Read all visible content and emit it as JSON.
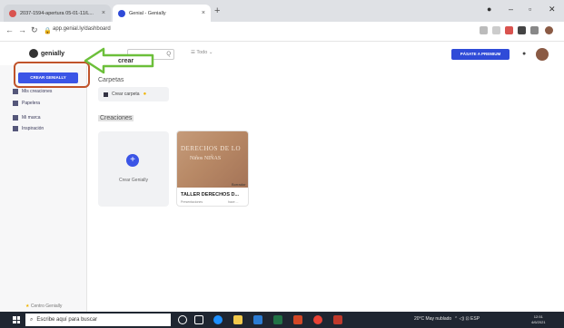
{
  "browser": {
    "tabs": [
      {
        "label": "2037-1594-apertura 05-01-11/L..."
      },
      {
        "label": "Genial - Genially"
      }
    ],
    "url": "app.genial.ly/dashboard"
  },
  "app": {
    "logo": "genially",
    "search_placeholder": "Q",
    "filter_label": "Todo",
    "premium_button": "PÁSATE A PREMIUM"
  },
  "sidebar": {
    "create_button": "CREAR GENIALLY",
    "items": [
      {
        "label": "Mis creaciones"
      },
      {
        "label": "Papelera"
      },
      {
        "label": "Mi marca"
      },
      {
        "label": "Inspiración"
      }
    ],
    "bottom_label": "Centro Genially"
  },
  "annotation": {
    "arrow_label": "crear",
    "arrow_color": "#6cbf3a",
    "highlight_color": "#c0532a"
  },
  "main": {
    "folders_title": "Carpetas",
    "folder_card": "Crear carpeta",
    "creations_title": "Creaciones",
    "create_card_label": "Crear Genially",
    "plus": "+",
    "creation": {
      "thumb_line1": "DERECHOS DE LO",
      "thumb_line2": "Niños NIÑAS",
      "badge": "Borrador",
      "title": "TALLER DERECHOS D...",
      "meta1": "Presentaciones",
      "meta2": "hace ..."
    }
  },
  "taskbar": {
    "search_placeholder": "Escribe aquí para buscar",
    "weather": "20°C May nublado",
    "lang": "ESP",
    "time": "12:51",
    "date": "4/6/2021"
  }
}
